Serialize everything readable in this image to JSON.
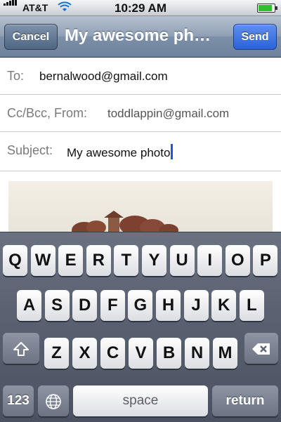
{
  "status_bar": {
    "carrier": "AT&T",
    "time": "10:29 AM",
    "battery_level": 0.9,
    "icons": [
      "signal-icon",
      "wifi-icon",
      "battery-icon"
    ]
  },
  "navbar": {
    "cancel_label": "Cancel",
    "title": "My awesome ph…",
    "send_label": "Send"
  },
  "compose": {
    "to_label": "To:",
    "to_value": "bernalwood@gmail.com",
    "ccbcc_label": "Cc/Bcc, From:",
    "from_value": "toddlappin@gmail.com",
    "subject_label": "Subject:",
    "subject_value": "My awesome photo"
  },
  "keyboard": {
    "row1": [
      "Q",
      "W",
      "E",
      "R",
      "T",
      "Y",
      "U",
      "I",
      "O",
      "P"
    ],
    "row2": [
      "A",
      "S",
      "D",
      "F",
      "G",
      "H",
      "J",
      "K",
      "L"
    ],
    "row3": [
      "Z",
      "X",
      "C",
      "V",
      "B",
      "N",
      "M"
    ],
    "numbers_label": "123",
    "space_label": "space",
    "return_label": "return",
    "icons": [
      "shift-icon",
      "backspace-icon",
      "globe-icon"
    ]
  },
  "colors": {
    "send_button": "#2a62d8",
    "caret": "#1e52f0"
  }
}
